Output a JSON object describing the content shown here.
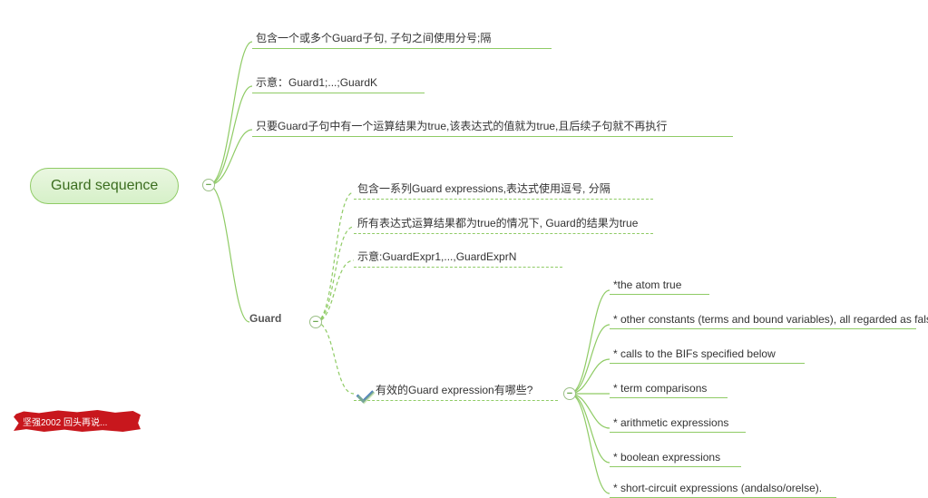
{
  "root": {
    "title": "Guard sequence"
  },
  "level1": {
    "n1": "包含一个或多个Guard子句, 子句之间使用分号;隔",
    "n2": "示意：Guard1;...;GuardK",
    "n3": "只要Guard子句中有一个运算结果为true,该表达式的值就为true,且后续子句就不再执行",
    "guard_label": "Guard"
  },
  "guard_children": {
    "g1": "包含一系列Guard expressions,表达式使用逗号, 分隔",
    "g2": "所有表达式运算结果都为true的情况下, Guard的结果为true",
    "g3": "示意:GuardExpr1,...,GuardExprN",
    "g4_label": "有效的Guard expression有哪些?"
  },
  "expr_children": {
    "e1": "*the atom true",
    "e2": "* other constants (terms and bound variables), all regarded as false",
    "e3": "* calls to the BIFs specified below",
    "e4": "* term comparisons",
    "e5": "* arithmetic expressions",
    "e6": "* boolean expressions",
    "e7": "* short-circuit expressions (andalso/orelse)."
  },
  "toggle_glyph": "−",
  "watermark": "坚强2002 回头再说..."
}
